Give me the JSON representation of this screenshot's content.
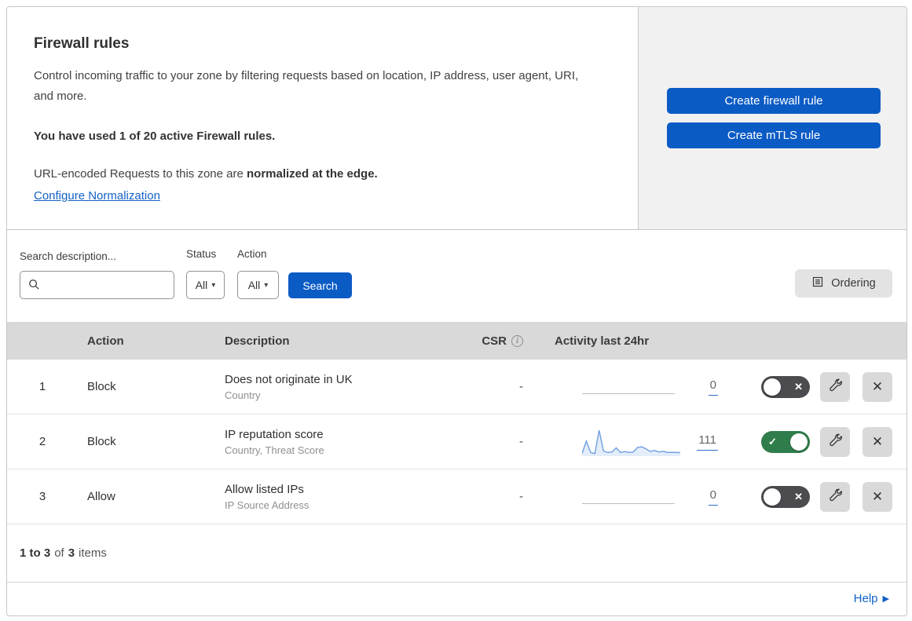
{
  "panel": {
    "title": "Firewall rules",
    "description": "Control incoming traffic to your zone by filtering requests based on location, IP address, user agent, URI, and more.",
    "usage_text": "You have used 1 of 20 active Firewall rules.",
    "normalization_prefix": "URL-encoded Requests to this zone are ",
    "normalization_bold": "normalized at the edge.",
    "normalization_link": "Configure Normalization",
    "create_firewall_button": "Create firewall rule",
    "create_mtls_button": "Create mTLS rule"
  },
  "filters": {
    "search_label": "Search description...",
    "search_value": "",
    "status_label": "Status",
    "status_value": "All",
    "action_label": "Action",
    "action_value": "All",
    "search_button": "Search",
    "ordering_button": "Ordering"
  },
  "table": {
    "headers": {
      "action": "Action",
      "description": "Description",
      "csr": "CSR",
      "activity": "Activity last 24hr"
    },
    "rows": [
      {
        "priority": "1",
        "action": "Block",
        "description": "Does not originate in UK",
        "fields": "Country",
        "csr": "-",
        "activity_count": "0",
        "enabled": false,
        "toggle_class": "toggle off",
        "toggle_glyph": "✕",
        "sparkline": []
      },
      {
        "priority": "2",
        "action": "Block",
        "description": "IP reputation score",
        "fields": "Country, Threat Score",
        "csr": "-",
        "activity_count": "111",
        "enabled": true,
        "toggle_class": "toggle on",
        "toggle_glyph": "✓",
        "sparkline": [
          4,
          52,
          8,
          4,
          95,
          14,
          8,
          10,
          26,
          8,
          12,
          8,
          10,
          28,
          30,
          22,
          12,
          16,
          10,
          13,
          8,
          9,
          8,
          8
        ]
      },
      {
        "priority": "3",
        "action": "Allow",
        "description": "Allow listed IPs",
        "fields": "IP Source Address",
        "csr": "-",
        "activity_count": "0",
        "enabled": false,
        "toggle_class": "toggle off",
        "toggle_glyph": "✕",
        "sparkline": []
      }
    ]
  },
  "footer": {
    "range_bold": "1 to 3",
    "of_text": "of",
    "total_bold": "3",
    "items_text": "items",
    "help_label": "Help",
    "help_arrow": "▶"
  },
  "icons": {
    "dropdown_arrow": "▾",
    "close": "✕",
    "info": "i"
  },
  "colors": {
    "accent_blue": "#0b5bc5",
    "link_blue": "#1161c5",
    "toggle_on_green": "#2f7d4a",
    "toggle_off_gray": "#4c4c50",
    "sparkline_blue": "#77a4e2"
  }
}
